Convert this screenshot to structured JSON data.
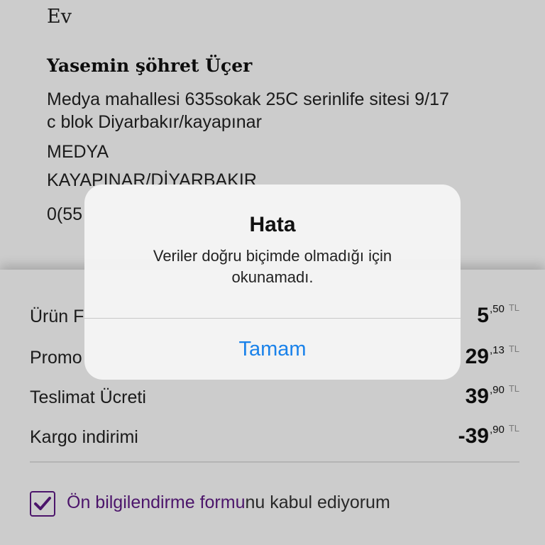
{
  "address": {
    "type_label": "Ev",
    "name": "Yasemin şöhret Üçer",
    "street_line1": "Medya mahallesi 635sokak 25C serinlife sitesi 9/17",
    "street_line2": "c blok Diyarbakır/kayapınar",
    "neighborhood": "MEDYA",
    "district_city": "KAYAPINAR/DİYARBAKIR",
    "phone_partial": "0(55"
  },
  "summary": {
    "rows": [
      {
        "label": "Ürün F",
        "value_main": "5",
        "value_decimal": ",50",
        "currency": "TL"
      },
      {
        "label": "Promo",
        "value_main": "29",
        "value_decimal": ",13",
        "currency": "TL"
      },
      {
        "label": "Teslimat Ücreti",
        "value_main": "39",
        "value_decimal": ",90",
        "currency": "TL"
      },
      {
        "label": "Kargo indirimi",
        "value_main": "-39",
        "value_decimal": ",90",
        "currency": "TL"
      }
    ],
    "consent": {
      "checked": true,
      "link_text": "Ön bilgilendirme formu",
      "rest_text": "nu kabul ediyorum"
    }
  },
  "alert": {
    "title": "Hata",
    "message": "Veriler doğru biçimde olmadığı için okunamadı.",
    "button_label": "Tamam"
  },
  "colors": {
    "accent_purple": "#5f1b86",
    "ios_blue": "#1a82ea"
  }
}
